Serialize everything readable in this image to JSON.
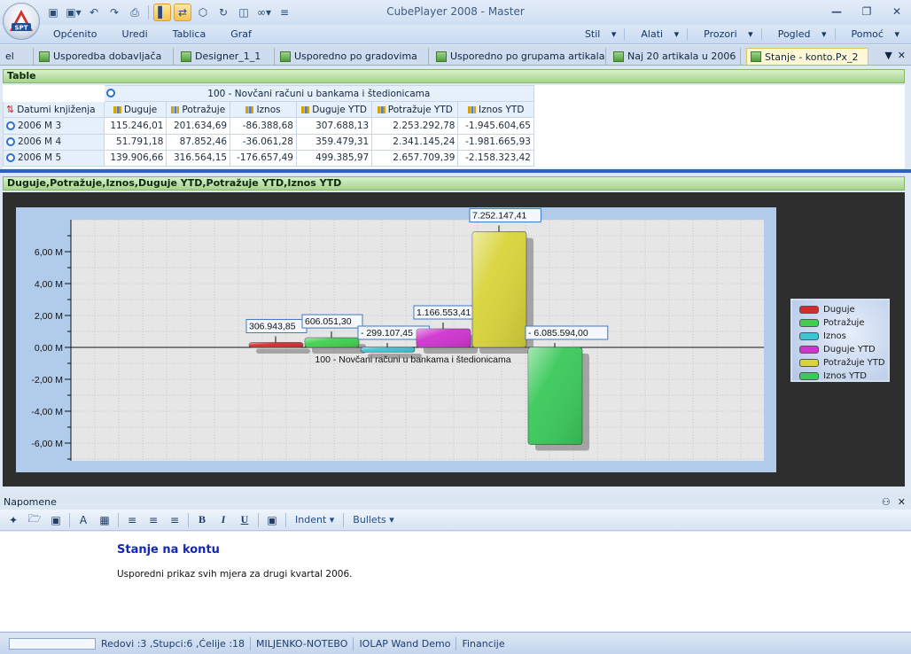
{
  "window": {
    "title": "CubePlayer 2008 - Master",
    "logo_text": "SPT"
  },
  "quick_access": {
    "icons": [
      "save-icon",
      "save-as-icon",
      "undo-icon",
      "redo-icon",
      "print-icon",
      "chart-icon",
      "swap-icon",
      "cube-icon",
      "refresh-icon",
      "export-icon",
      "connect-icon",
      "customize-icon"
    ]
  },
  "menu": {
    "left": [
      "Općenito",
      "Uredi",
      "Tablica",
      "Graf"
    ],
    "right": [
      "Stil",
      "Alati",
      "Prozori",
      "Pogled",
      "Pomoć"
    ]
  },
  "tabs": [
    {
      "label": "el",
      "active": false
    },
    {
      "label": "Usporedba dobavljača",
      "active": false
    },
    {
      "label": "Designer_1_1",
      "active": false
    },
    {
      "label": "Usporedno po gradovima",
      "active": false
    },
    {
      "label": "Usporedno po grupama artikala",
      "active": false
    },
    {
      "label": "Naj 20 artikala u 2006",
      "active": false
    },
    {
      "label": "Stanje - konto.Px_2",
      "active": true
    }
  ],
  "table_panel": {
    "title": "Table",
    "account_header": "100 - Novčani računi u bankama i štedionicama",
    "row_dimension": "Datumi knjiženja",
    "columns": [
      "Duguje",
      "Potražuje",
      "Iznos",
      "Duguje YTD",
      "Potražuje YTD",
      "Iznos YTD"
    ],
    "rows": [
      {
        "label": "2006 M 3",
        "values": [
          "115.246,01",
          "201.634,69",
          "-86.388,68",
          "307.688,13",
          "2.253.292,78",
          "-1.945.604,65"
        ]
      },
      {
        "label": "2006 M 4",
        "values": [
          "51.791,18",
          "87.852,46",
          "-36.061,28",
          "359.479,31",
          "2.341.145,24",
          "-1.981.665,93"
        ]
      },
      {
        "label": "2006 M 5",
        "values": [
          "139.906,66",
          "316.564,15",
          "-176.657,49",
          "499.385,97",
          "2.657.709,39",
          "-2.158.323,42"
        ]
      }
    ]
  },
  "chart_panel": {
    "title": "Duguje,Potražuje,Iznos,Duguje YTD,Potražuje YTD,Iznos YTD"
  },
  "chart_data": {
    "type": "bar",
    "categories": [
      "100 - Novčani računi u bankama i štedionicama"
    ],
    "xlabel": "",
    "ylabel": "",
    "ylim": [
      -7000000,
      7500000
    ],
    "yticks": [
      -6000000,
      -4000000,
      -2000000,
      0,
      2000000,
      4000000,
      6000000
    ],
    "ytick_labels": [
      "-6,00 M",
      "-4,00 M",
      "-2,00 M",
      "0,00 M",
      "2,00 M",
      "4,00 M",
      "6,00 M"
    ],
    "grid": true,
    "legend": "right",
    "series": [
      {
        "name": "Duguje",
        "values": [
          306943.85
        ],
        "label": "306.943,85",
        "color": "#d62b2b"
      },
      {
        "name": "Potražuje",
        "values": [
          606051.3
        ],
        "label": "606.051,30",
        "color": "#3fd04f"
      },
      {
        "name": "Iznos",
        "values": [
          -299107.45
        ],
        "label": "- 299.107,45",
        "color": "#3bc4d4"
      },
      {
        "name": "Duguje YTD",
        "values": [
          1166553.41
        ],
        "label": "1.166.553,41",
        "color": "#cf33cf"
      },
      {
        "name": "Potražuje YTD",
        "values": [
          7252147.41
        ],
        "label": "7.252.147,41",
        "color": "#d8d43a"
      },
      {
        "name": "Iznos YTD",
        "values": [
          -6085594.0
        ],
        "label": "- 6.085.594,00",
        "color": "#3ac95a"
      }
    ]
  },
  "notes": {
    "panel_title": "Napomene",
    "toolbar": {
      "indent": "Indent",
      "bullets": "Bullets"
    },
    "title": "Stanje na kontu",
    "text": "Usporedni prikaz svih mjera za drugi kvartal 2006."
  },
  "status": {
    "counts": "Redovi :3 ,Stupci:6 ,Ćelije :18",
    "machine": "MILJENKO-NOTEBO",
    "app": "IOLAP Wand Demo",
    "cube": "Financije"
  }
}
